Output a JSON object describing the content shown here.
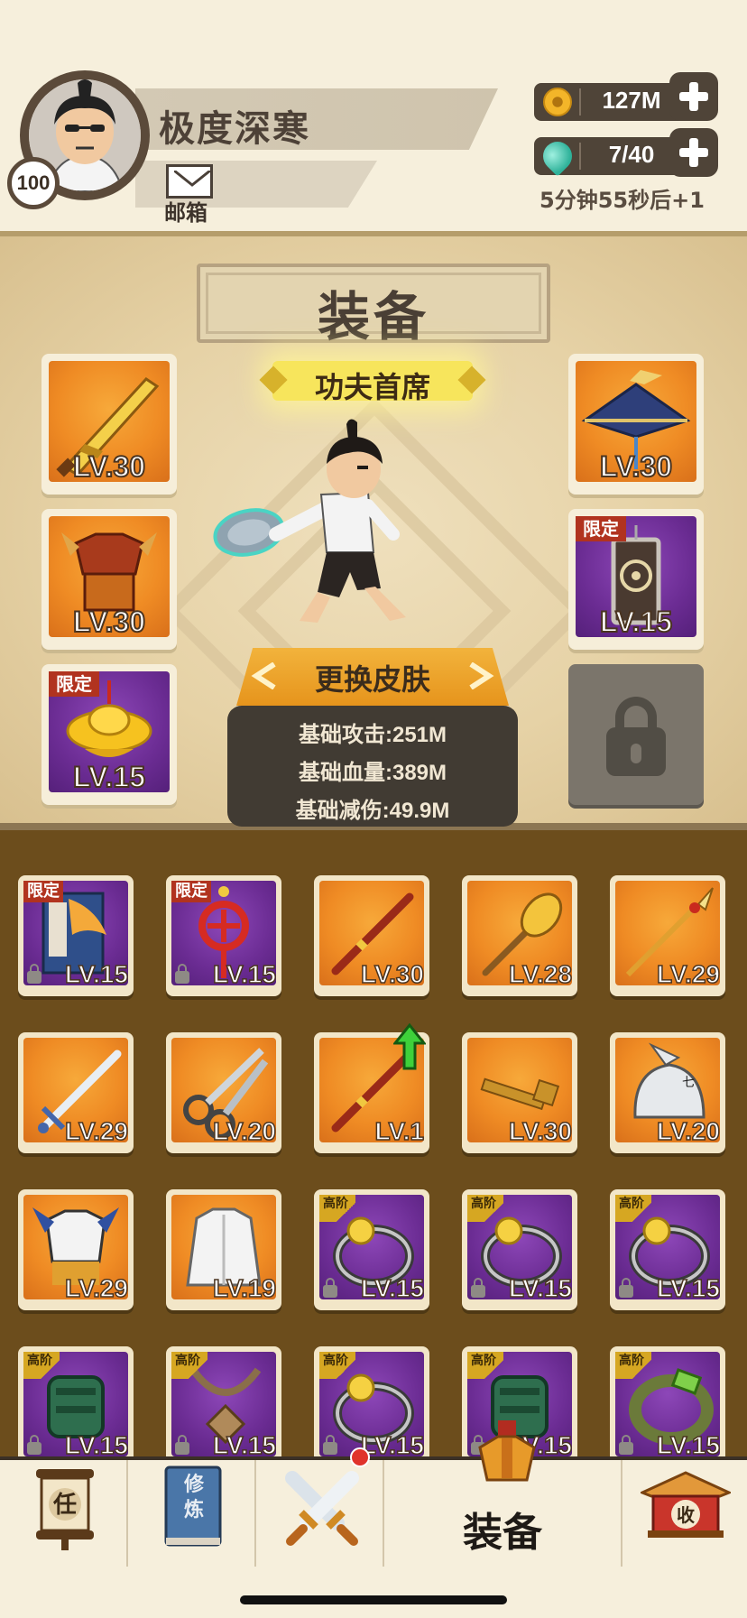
{
  "player": {
    "name": "极度深寒",
    "level": "100",
    "mail_label": "邮箱"
  },
  "resources": {
    "gold": "127M",
    "stamina": "7/40",
    "regen_text": "5分钟55秒后+1"
  },
  "panel": {
    "title": "装备",
    "rank_title": "功夫首席",
    "skin_button": "更换皮肤",
    "stats": {
      "attack": "基础攻击:251M",
      "hp": "基础血量:389M",
      "reduction": "基础减伤:49.9M"
    }
  },
  "equipped": {
    "left": [
      {
        "name": "golden-sword",
        "level": "LV.30",
        "rarity": "orange"
      },
      {
        "name": "armor",
        "level": "LV.30",
        "rarity": "orange"
      },
      {
        "name": "gold-ingot",
        "level": "LV.15",
        "rarity": "purple",
        "tag": "限定"
      }
    ],
    "right": [
      {
        "name": "bamboo-hat",
        "level": "LV.30",
        "rarity": "orange"
      },
      {
        "name": "pendant",
        "level": "LV.15",
        "rarity": "purple",
        "tag": "限定"
      }
    ]
  },
  "inventory": [
    {
      "name": "book",
      "level": "LV.15",
      "rarity": "purple",
      "tag": "限定",
      "locked": true
    },
    {
      "name": "chinese-knot",
      "level": "LV.15",
      "rarity": "purple",
      "tag": "限定",
      "locked": true
    },
    {
      "name": "staff",
      "level": "LV.30",
      "rarity": "orange"
    },
    {
      "name": "mace",
      "level": "LV.28",
      "rarity": "orange"
    },
    {
      "name": "spear",
      "level": "LV.29",
      "rarity": "orange"
    },
    {
      "name": "sword",
      "level": "LV.29",
      "rarity": "orange"
    },
    {
      "name": "scissors",
      "level": "LV.20",
      "rarity": "orange"
    },
    {
      "name": "staff",
      "level": "LV.1",
      "rarity": "orange",
      "upgrade": true
    },
    {
      "name": "key",
      "level": "LV.30",
      "rarity": "orange"
    },
    {
      "name": "helmet",
      "level": "LV.20",
      "rarity": "orange"
    },
    {
      "name": "armor-blue",
      "level": "LV.29",
      "rarity": "orange"
    },
    {
      "name": "hoodie",
      "level": "LV.19",
      "rarity": "orange"
    },
    {
      "name": "ring",
      "level": "LV.15",
      "rarity": "purple",
      "tag": "高阶",
      "locked": true
    },
    {
      "name": "ring",
      "level": "LV.15",
      "rarity": "purple",
      "tag": "高阶",
      "locked": true
    },
    {
      "name": "ring",
      "level": "LV.15",
      "rarity": "purple",
      "tag": "高阶",
      "locked": true
    },
    {
      "name": "bracer",
      "level": "LV.15",
      "rarity": "purple",
      "tag": "高阶",
      "locked": true
    },
    {
      "name": "necklace",
      "level": "LV.15",
      "rarity": "purple",
      "tag": "高阶",
      "locked": true
    },
    {
      "name": "ring",
      "level": "LV.15",
      "rarity": "purple",
      "tag": "高阶",
      "locked": true
    },
    {
      "name": "bracer",
      "level": "LV.15",
      "rarity": "purple",
      "tag": "高阶",
      "locked": true
    },
    {
      "name": "bracelet",
      "level": "LV.15",
      "rarity": "purple",
      "tag": "高阶",
      "locked": true
    }
  ],
  "nav": {
    "task_char": "任",
    "cultivate_text": "修炼",
    "equip_label": "装备",
    "collect_char": "收"
  },
  "colors": {
    "background": "#f6efdc",
    "inventory_bg": "#6c4d1c",
    "orange_rarity": "#ef8b24",
    "purple_rarity": "#6b2c93",
    "limited_tag": "#b1331f"
  }
}
